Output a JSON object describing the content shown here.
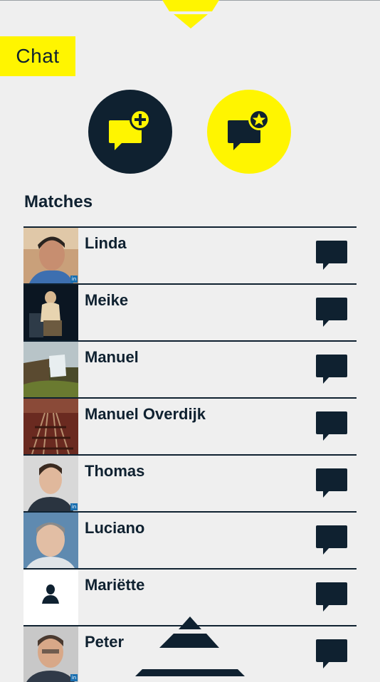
{
  "header": {
    "tab_label": "Chat"
  },
  "actions": {
    "new_chat_icon": "chat-add-icon",
    "favorite_chat_icon": "chat-star-icon"
  },
  "matches": {
    "title": "Matches",
    "items": [
      {
        "name": "Linda",
        "linkedin": true
      },
      {
        "name": "Meike",
        "linkedin": false
      },
      {
        "name": "Manuel",
        "linkedin": false
      },
      {
        "name": "Manuel Overdijk",
        "linkedin": false
      },
      {
        "name": "Thomas",
        "linkedin": true
      },
      {
        "name": "Luciano",
        "linkedin": false
      },
      {
        "name": "Mariëtte",
        "linkedin": false
      },
      {
        "name": "Peter",
        "linkedin": true
      }
    ]
  },
  "colors": {
    "accent_yellow": "#fff500",
    "dark_navy": "#0f2130",
    "background": "#efefef"
  },
  "badge": {
    "linkedin": "in"
  }
}
